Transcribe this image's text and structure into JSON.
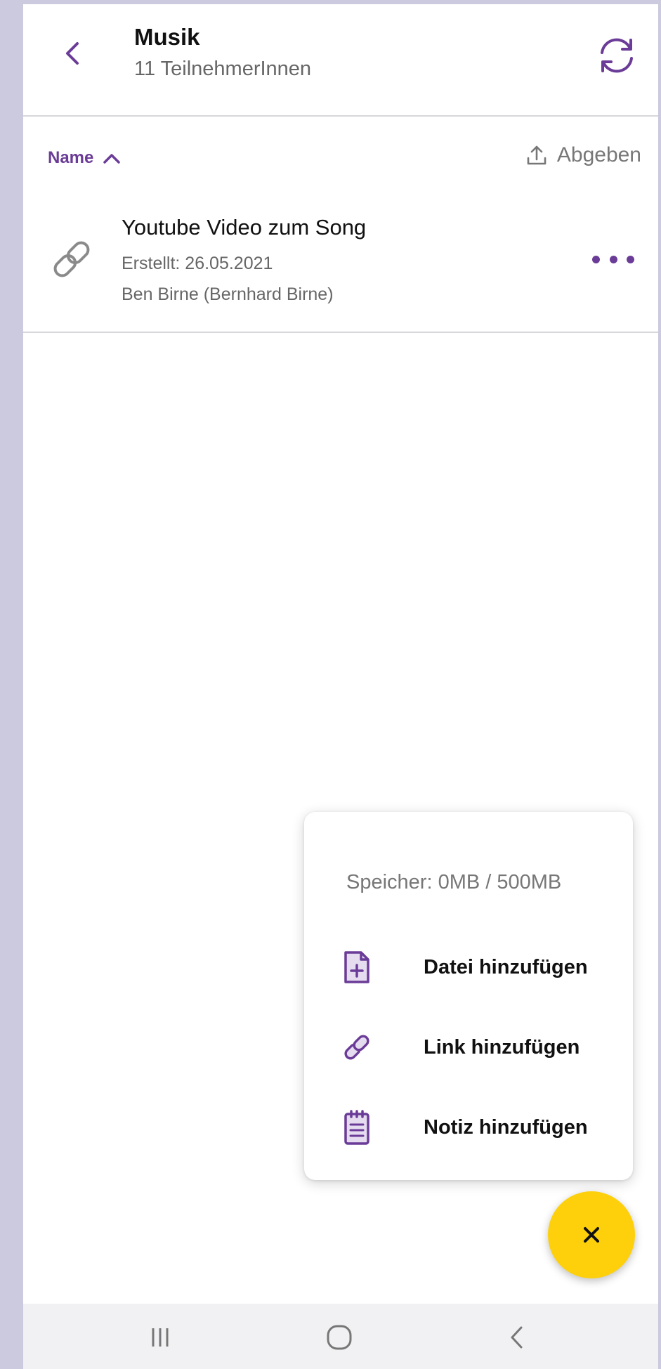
{
  "header": {
    "title": "Musik",
    "subtitle": "11 TeilnehmerInnen",
    "back_icon": "chevron-left-icon",
    "refresh_icon": "refresh-icon"
  },
  "sort": {
    "label": "Name",
    "direction_icon": "chevron-up-icon"
  },
  "submit": {
    "label": "Abgeben",
    "icon": "upload-icon"
  },
  "items": [
    {
      "title": "Youtube Video zum Song",
      "created": "Erstellt: 26.05.2021",
      "author": "Ben Birne (Bernhard Birne)",
      "icon": "link-icon"
    }
  ],
  "menu": {
    "storage": "Speicher: 0MB / 500MB",
    "items": [
      {
        "label": "Datei hinzufügen",
        "icon": "file-add-icon"
      },
      {
        "label": "Link hinzufügen",
        "icon": "link-icon"
      },
      {
        "label": "Notiz hinzufügen",
        "icon": "note-icon"
      }
    ]
  },
  "fab": {
    "icon": "close-icon"
  },
  "colors": {
    "accent": "#6b3c97",
    "fab": "#fdd00b",
    "background": "#cbcade"
  }
}
